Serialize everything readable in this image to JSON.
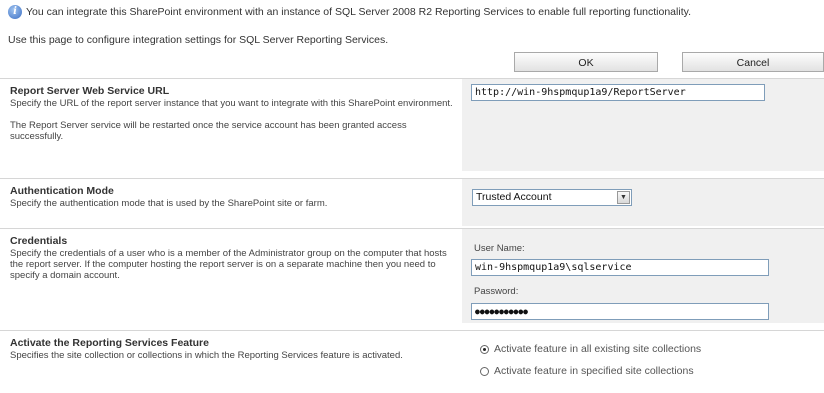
{
  "header": {
    "info_text": "You can integrate this SharePoint environment with an instance of SQL Server 2008 R2 Reporting Services to enable full reporting functionality.",
    "sub_text": "Use this page to configure integration settings for SQL Server Reporting Services."
  },
  "buttons": {
    "ok_label": "OK",
    "cancel_label": "Cancel"
  },
  "sections": {
    "url": {
      "title": "Report Server Web Service URL",
      "desc1": "Specify the URL of the report server instance that you want to integrate with this SharePoint environment.",
      "desc2": "The Report Server service will be restarted once the service account has been granted access successfully.",
      "value": "http://win-9hspmqup1a9/ReportServer"
    },
    "auth": {
      "title": "Authentication Mode",
      "desc": "Specify the authentication mode that is used by the SharePoint site or farm.",
      "selected": "Trusted Account"
    },
    "credentials": {
      "title": "Credentials",
      "desc": "Specify the credentials of a user who is a member of the Administrator group on the computer that hosts the report server. If the computer hosting the report server is on a separate machine then you need to specify a domain account.",
      "username_label": "User Name:",
      "username_value": "win-9hspmqup1a9\\sqlservice",
      "password_label": "Password:",
      "password_mask": "●●●●●●●●●●●"
    },
    "feature": {
      "title": "Activate the Reporting Services Feature",
      "desc": "Specifies the site collection or collections in which the Reporting Services feature is activated.",
      "option_all": "Activate feature in all existing site collections",
      "option_specified": "Activate feature in specified site collections"
    }
  }
}
